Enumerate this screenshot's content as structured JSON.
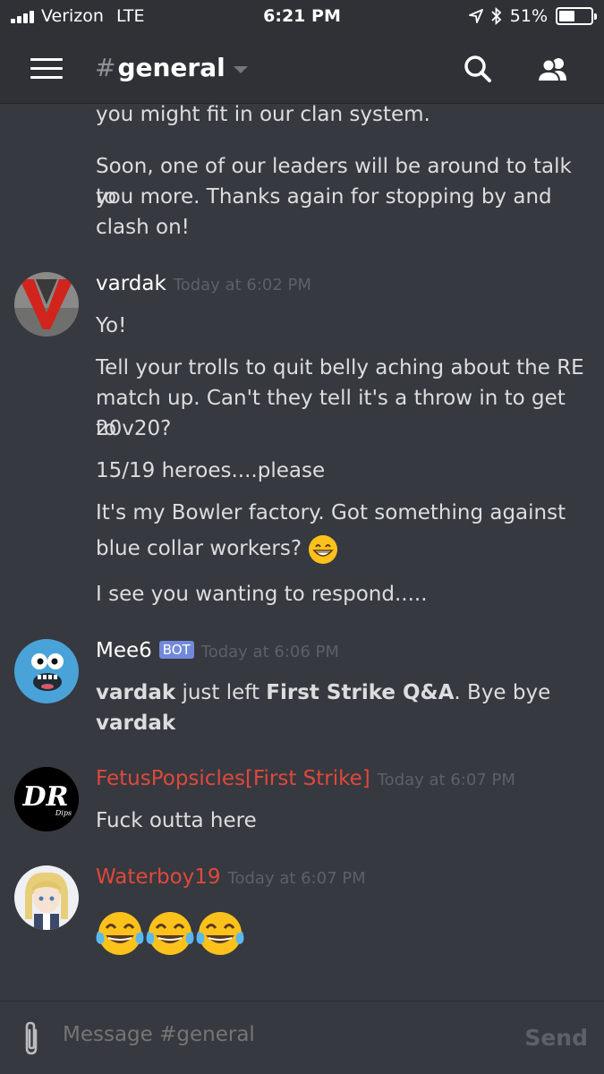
{
  "status_bar": {
    "carrier": "Verizon",
    "network": "LTE",
    "time": "6:21 PM",
    "battery": "51%",
    "battery_level": 0.51
  },
  "header": {
    "hash": "#",
    "channel": "general"
  },
  "messages": {
    "continued": {
      "lines": [
        "you might fit in our clan system.",
        "Soon, one of our leaders will be around to talk to",
        "you more. Thanks again for stopping by and",
        "clash on!"
      ]
    },
    "vardak": {
      "username": "vardak",
      "timestamp": "Today at 6:02 PM",
      "lines": [
        "Yo!",
        "Tell your trolls to quit belly aching about the RE",
        "match up. Can't they tell it's a throw in to get to",
        "20v20?",
        "15/19 heroes....please",
        "It's my Bowler factory. Got something against",
        "blue collar workers?",
        "I see you wanting to respond....."
      ],
      "emoji": "grinning-face"
    },
    "mee6": {
      "username": "Mee6",
      "bot_tag": "BOT",
      "timestamp": "Today at 6:06 PM",
      "bold1": "vardak",
      "text1": " just left ",
      "bold2": "First Strike Q&A",
      "text2": ". Bye bye",
      "bold3": "vardak"
    },
    "fetus": {
      "username": "FetusPopsicles[First Strike]",
      "timestamp": "Today at 6:07 PM",
      "text": "Fuck outta here",
      "avatar_text": "DR",
      "avatar_sub": "Dips"
    },
    "waterboy": {
      "username": "Waterboy19",
      "timestamp": "Today at 6:07 PM",
      "emoji": "face-with-tears-of-joy x3"
    }
  },
  "composer": {
    "placeholder": "Message #general",
    "send_label": "Send"
  },
  "colors": {
    "background": "#36393f",
    "header": "#2f3136",
    "role_red": "#e0483c",
    "bot_tag": "#7289da",
    "muted": "#5d6066"
  }
}
